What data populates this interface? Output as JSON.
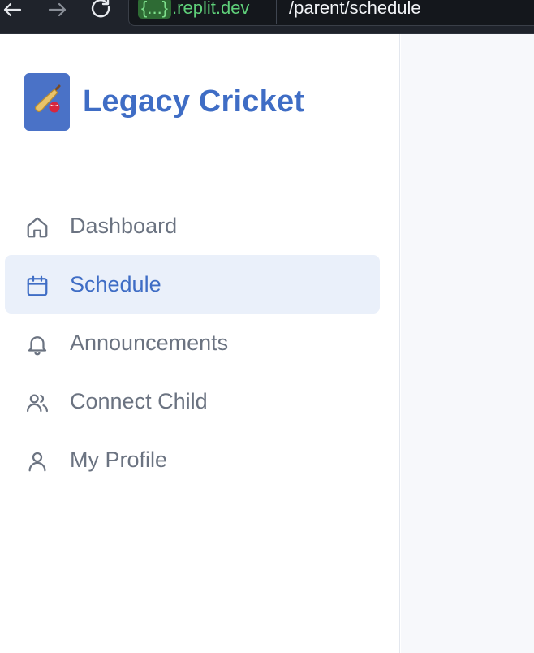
{
  "browser": {
    "host_placeholder": "{...}",
    "host_suffix": ".replit.dev",
    "path": "/parent/schedule"
  },
  "brand": {
    "title": "Legacy Cricket",
    "logo_icon": "cricket-bat-icon"
  },
  "sidebar": {
    "items": [
      {
        "label": "Dashboard",
        "icon": "home-icon",
        "active": false
      },
      {
        "label": "Schedule",
        "icon": "calendar-icon",
        "active": true
      },
      {
        "label": "Announcements",
        "icon": "bell-icon",
        "active": false
      },
      {
        "label": "Connect Child",
        "icon": "users-icon",
        "active": false
      },
      {
        "label": "My Profile",
        "icon": "user-icon",
        "active": false
      }
    ]
  },
  "colors": {
    "accent": "#3f6dc5",
    "active_bg": "#eaf0fa",
    "muted_text": "#6b7381"
  }
}
